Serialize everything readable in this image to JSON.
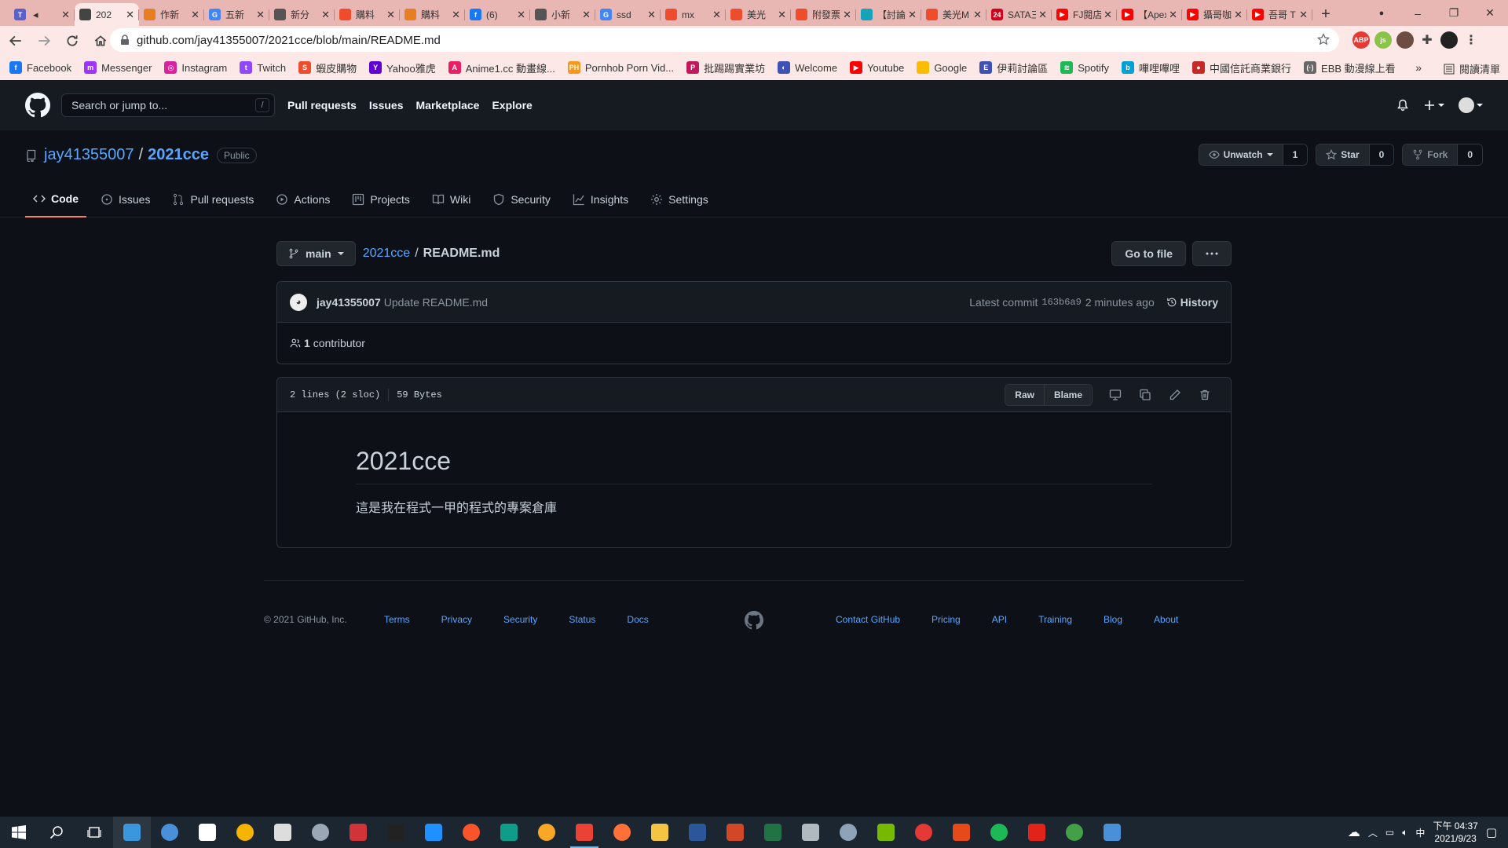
{
  "browser": {
    "tabs": [
      {
        "title": "",
        "color": "#5b5fc7",
        "glyph": "T",
        "close": "✕",
        "muted": true
      },
      {
        "title": "202",
        "color": "#444",
        "glyph": "",
        "close": "✕",
        "active": true
      },
      {
        "title": "作新",
        "color": "#e67e22",
        "glyph": "",
        "close": "✕"
      },
      {
        "title": "五新",
        "color": "#4285f4",
        "glyph": "G",
        "close": "✕"
      },
      {
        "title": "新分",
        "color": "#555",
        "glyph": "",
        "close": "✕"
      },
      {
        "title": "購料",
        "color": "#ee4d2d",
        "glyph": "",
        "close": "✕"
      },
      {
        "title": "購料",
        "color": "#e67e22",
        "glyph": "",
        "close": "✕"
      },
      {
        "title": "(6)",
        "color": "#1877f2",
        "glyph": "f",
        "close": "✕"
      },
      {
        "title": "小新",
        "color": "#555",
        "glyph": "",
        "close": "✕"
      },
      {
        "title": "ssd",
        "color": "#4285f4",
        "glyph": "G",
        "close": "✕"
      },
      {
        "title": "mx",
        "color": "#ee4d2d",
        "glyph": "",
        "close": "✕"
      },
      {
        "title": "美光",
        "color": "#ee4d2d",
        "glyph": "",
        "close": "✕"
      },
      {
        "title": "附發票",
        "color": "#ee4d2d",
        "glyph": "",
        "close": "✕"
      },
      {
        "title": "【討論",
        "color": "#17a2b8",
        "glyph": "",
        "close": "✕"
      },
      {
        "title": "美光M",
        "color": "#ee4d2d",
        "glyph": "",
        "close": "✕"
      },
      {
        "title": "SATA三",
        "color": "#d0021b",
        "glyph": "24",
        "close": "✕"
      },
      {
        "title": "FJ閱店",
        "color": "#ff0000",
        "glyph": "▶",
        "close": "✕"
      },
      {
        "title": "【Apex",
        "color": "#ff0000",
        "glyph": "▶",
        "close": "✕"
      },
      {
        "title": "攝哥咖",
        "color": "#ff0000",
        "glyph": "▶",
        "close": "✕"
      },
      {
        "title": "吾哥 T",
        "color": "#ff0000",
        "glyph": "▶",
        "close": "✕"
      }
    ],
    "new_tab": "+",
    "window_controls": [
      "–",
      "❐",
      "✕"
    ],
    "url": "github.com/jay41355007/2021cce/blob/main/README.md",
    "bookmarks": [
      {
        "label": "Facebook",
        "color": "#1877f2",
        "glyph": "f"
      },
      {
        "label": "Messenger",
        "color": "#a033ff",
        "glyph": "m"
      },
      {
        "label": "Instagram",
        "color": "#d6249f",
        "glyph": "◎"
      },
      {
        "label": "Twitch",
        "color": "#9146ff",
        "glyph": "t"
      },
      {
        "label": "蝦皮購物",
        "color": "#ee4d2d",
        "glyph": "S"
      },
      {
        "label": "Yahoo雅虎",
        "color": "#6001d2",
        "glyph": "Y"
      },
      {
        "label": "Anime1.cc 動畫線...",
        "color": "#e91e63",
        "glyph": "A"
      },
      {
        "label": "Pornhob Porn Vid...",
        "color": "#f7971d",
        "glyph": "PH"
      },
      {
        "label": "批踢踢實業坊",
        "color": "#c2185b",
        "glyph": "P"
      },
      {
        "label": "Welcome",
        "color": "#3f51b5",
        "glyph": "◐"
      },
      {
        "label": "Youtube",
        "color": "#ff0000",
        "glyph": "▶"
      },
      {
        "label": "Google",
        "color": "#fbbc04",
        "glyph": ""
      },
      {
        "label": "伊莉討論區",
        "color": "#3f51b5",
        "glyph": "E"
      },
      {
        "label": "Spotify",
        "color": "#1db954",
        "glyph": "≋"
      },
      {
        "label": "嗶哩嗶哩",
        "color": "#00a1d6",
        "glyph": "b"
      },
      {
        "label": "中國信託商業銀行",
        "color": "#c62828",
        "glyph": "●"
      },
      {
        "label": "EBB 動漫線上看",
        "color": "#666",
        "glyph": "(·)"
      }
    ],
    "bookmarks_more": "»",
    "reading_list": "閱讀清單"
  },
  "github": {
    "search_placeholder": "Search or jump to...",
    "search_shortcut": "/",
    "nav": [
      "Pull requests",
      "Issues",
      "Marketplace",
      "Explore"
    ],
    "repo": {
      "owner": "jay41355007",
      "separator": "/",
      "name": "2021cce",
      "visibility": "Public",
      "watch_label": "Unwatch",
      "watch_count": "1",
      "star_label": "Star",
      "star_count": "0",
      "fork_label": "Fork",
      "fork_count": "0"
    },
    "tabs": [
      {
        "label": "Code",
        "icon": "code-icon",
        "active": true
      },
      {
        "label": "Issues",
        "icon": "issue-icon"
      },
      {
        "label": "Pull requests",
        "icon": "pull-request-icon"
      },
      {
        "label": "Actions",
        "icon": "play-icon"
      },
      {
        "label": "Projects",
        "icon": "project-icon"
      },
      {
        "label": "Wiki",
        "icon": "book-icon"
      },
      {
        "label": "Security",
        "icon": "shield-icon"
      },
      {
        "label": "Insights",
        "icon": "graph-icon"
      },
      {
        "label": "Settings",
        "icon": "gear-icon"
      }
    ],
    "file": {
      "branch": "main",
      "breadcrumb_repo": "2021cce",
      "breadcrumb_sep": "/",
      "breadcrumb_file": "README.md",
      "go_to_file": "Go to file",
      "commit_author": "jay41355007",
      "commit_message": "Update README.md",
      "latest_commit_label": "Latest commit",
      "commit_sha": "163b6a9",
      "commit_time": "2 minutes ago",
      "history_label": "History",
      "contributor_count": "1",
      "contributor_label": "contributor",
      "lines_info": "2 lines (2 sloc)",
      "size_info": "59 Bytes",
      "raw_label": "Raw",
      "blame_label": "Blame",
      "readme_title": "2021cce",
      "readme_body": "這是我在程式一甲的程式的專案倉庫"
    },
    "footer": {
      "copyright": "© 2021 GitHub, Inc.",
      "left_links": [
        "Terms",
        "Privacy",
        "Security",
        "Status",
        "Docs"
      ],
      "right_links": [
        "Contact GitHub",
        "Pricing",
        "API",
        "Training",
        "Blog",
        "About"
      ]
    }
  },
  "taskbar": {
    "apps": [
      {
        "name": "windows-start-icon",
        "color": "#ffffff"
      },
      {
        "name": "search-icon",
        "color": "#ffffff"
      },
      {
        "name": "task-view-icon",
        "color": "#ffffff"
      },
      {
        "name": "app-icon",
        "color": "#3a96dd",
        "open": true
      },
      {
        "name": "app-icon",
        "color": "#4a90d9"
      },
      {
        "name": "store-icon",
        "color": "#ffffff"
      },
      {
        "name": "app-icon",
        "color": "#f4b400"
      },
      {
        "name": "settings-icon",
        "color": "#dddddd"
      },
      {
        "name": "app-icon",
        "color": "#9aa7b5"
      },
      {
        "name": "app-icon",
        "color": "#d13438"
      },
      {
        "name": "terminal-icon",
        "color": "#222222"
      },
      {
        "name": "ie-icon",
        "color": "#1e90ff"
      },
      {
        "name": "brave-icon",
        "color": "#fb542b"
      },
      {
        "name": "edge-icon",
        "color": "#0f9d8a"
      },
      {
        "name": "app-icon",
        "color": "#f9a825"
      },
      {
        "name": "chrome-icon",
        "color": "#ea4335",
        "active": true
      },
      {
        "name": "firefox-icon",
        "color": "#ff7139"
      },
      {
        "name": "folder-icon",
        "color": "#f4c542"
      },
      {
        "name": "word-icon",
        "color": "#2b579a"
      },
      {
        "name": "powerpoint-icon",
        "color": "#d24726"
      },
      {
        "name": "excel-icon",
        "color": "#217346"
      },
      {
        "name": "app-icon",
        "color": "#b0b8c0"
      },
      {
        "name": "app-icon",
        "color": "#8fa3b8"
      },
      {
        "name": "nvidia-icon",
        "color": "#76b900"
      },
      {
        "name": "app-icon",
        "color": "#e53935"
      },
      {
        "name": "app-icon",
        "color": "#e64a19"
      },
      {
        "name": "spotify-icon",
        "color": "#1db954"
      },
      {
        "name": "acrobat-icon",
        "color": "#e2231a"
      },
      {
        "name": "app-icon",
        "color": "#43a047"
      },
      {
        "name": "app-icon",
        "color": "#4a90d9"
      }
    ],
    "ime": "中",
    "time": "下午 04:37",
    "date": "2021/9/23"
  }
}
